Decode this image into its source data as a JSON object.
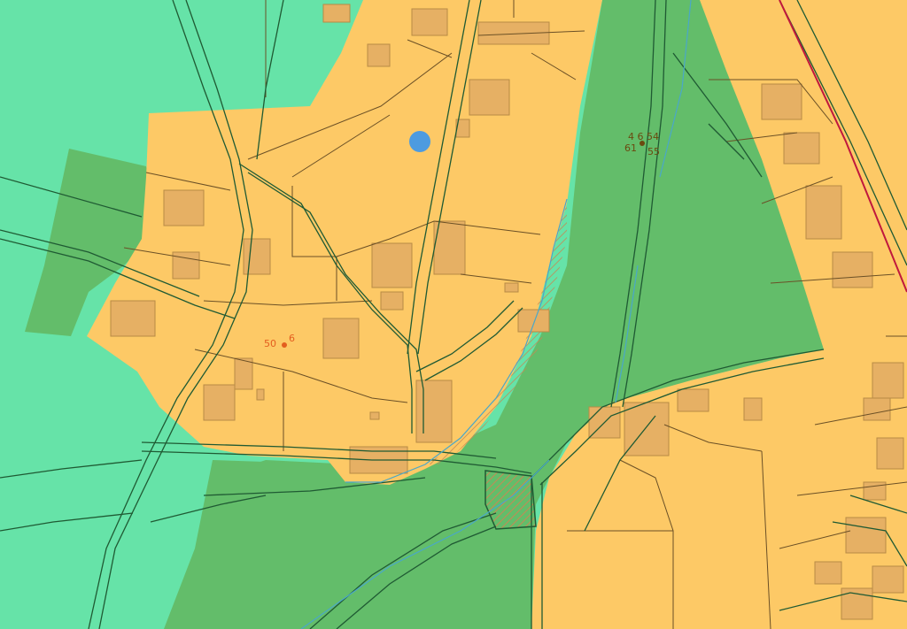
{
  "colors": {
    "water_zone": "#66e3a8",
    "forest_zone": "#63bd6a",
    "urban_zone": "#fdc966",
    "building": "#e6b064",
    "parcel_line": "#6b5026",
    "road_line": "#1f5a33",
    "railway": "#c0183d",
    "stream": "#4aa7c9",
    "location_marker": "#4d9be0",
    "label_orange": "#e35d1f",
    "label_brown": "#6b4a10"
  },
  "markers": {
    "current_location": {
      "icon": "location-dot-icon"
    }
  },
  "labels": {
    "point_a_left": "50",
    "point_a_right": "6",
    "point_b_top_left": "4 6",
    "point_b_top_right": "54",
    "point_b_bottom_left": "61",
    "point_b_bottom_right": "55"
  }
}
